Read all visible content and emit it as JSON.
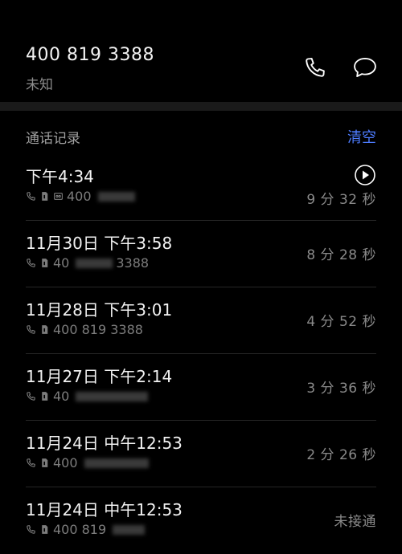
{
  "contact": {
    "number": "400 819 3388",
    "location": "未知",
    "call_icon": "phone-icon",
    "message_icon": "message-icon"
  },
  "call_log": {
    "title": "通话记录",
    "clear_label": "清空",
    "entries": [
      {
        "datetime": "下午4:34",
        "number": "400",
        "duration": "9 分 32 秒",
        "has_recording": true
      },
      {
        "datetime": "11月30日 下午3:58",
        "number": "40",
        "number_tail": "3388",
        "duration": "8 分 28 秒",
        "has_recording": false
      },
      {
        "datetime": "11月28日 下午3:01",
        "number": "400 819 3388",
        "duration": "4 分 52 秒",
        "has_recording": false
      },
      {
        "datetime": "11月27日 下午2:14",
        "number": "40",
        "duration": "3 分 36 秒",
        "has_recording": false
      },
      {
        "datetime": "11月24日 中午12:53",
        "number": "400",
        "duration": "2 分 26 秒",
        "has_recording": false
      },
      {
        "datetime": "11月24日 中午12:53",
        "number": "400 819",
        "duration": "未接通",
        "has_recording": false
      }
    ]
  },
  "colors": {
    "background": "#000000",
    "accent": "#4d7cfe",
    "primary_text": "#f2f2f2",
    "secondary_text": "#8a8a8a"
  }
}
